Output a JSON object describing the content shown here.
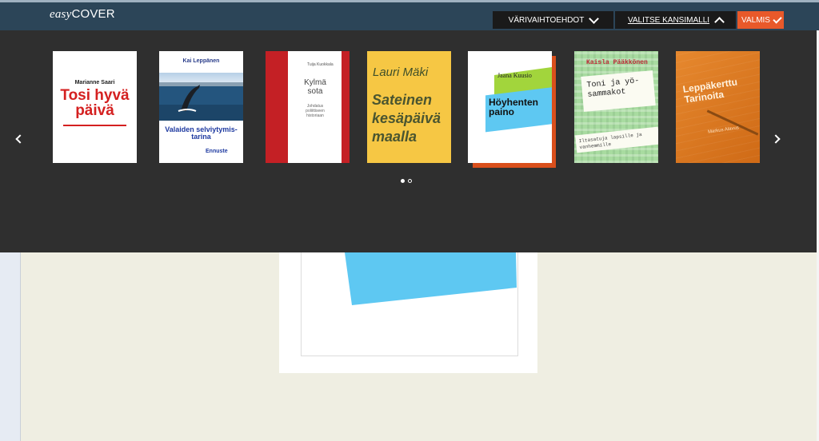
{
  "header": {
    "logo_easy": "easy",
    "logo_cover": "COVER",
    "color_options_label": "VÄRIVAIHTOEHDOT",
    "choose_template_label": "VALITSE KANSIMALLI",
    "done_label": "VALMIS"
  },
  "carousel": {
    "covers": [
      {
        "author": "Marianne Saari",
        "title": "Tosi hyvä päivä"
      },
      {
        "author": "Kai Leppänen",
        "title": "Valaiden selviytymis-tarina",
        "publisher": "Ennuste"
      },
      {
        "author": "Tuija Kuokkala",
        "title": "Kylmä sota",
        "subtitle": "Johdatus poliittiseen historiaan"
      },
      {
        "author": "Lauri Mäki",
        "title": "Sateinen kesäpäivä maalla"
      },
      {
        "author": "Jaana Kuusio",
        "title": "Höyhenten paino"
      },
      {
        "author": "Kaisla Pääkkönen",
        "title": "Toni ja yö-sammakot",
        "subtitle": "Iltasatuja lapsille ja vanhemmille"
      },
      {
        "title": "Leppäkerttu",
        "subtitle": "Tarinoita",
        "author": "Markus Alavus"
      }
    ],
    "page_count": 2,
    "active_page": 1
  },
  "colors": {
    "header_bg": "#2c4558",
    "panel_bg": "#2f2f2f",
    "done_bg": "#e8592a",
    "canvas_bg": "#efeee2",
    "preview_blue": "#5ec8f2"
  },
  "icons": {
    "prev": "chevron-left-icon",
    "next": "chevron-right-icon",
    "color_options": "chevron-down-icon",
    "choose_template": "chevron-up-icon",
    "done": "checkmark-icon"
  }
}
